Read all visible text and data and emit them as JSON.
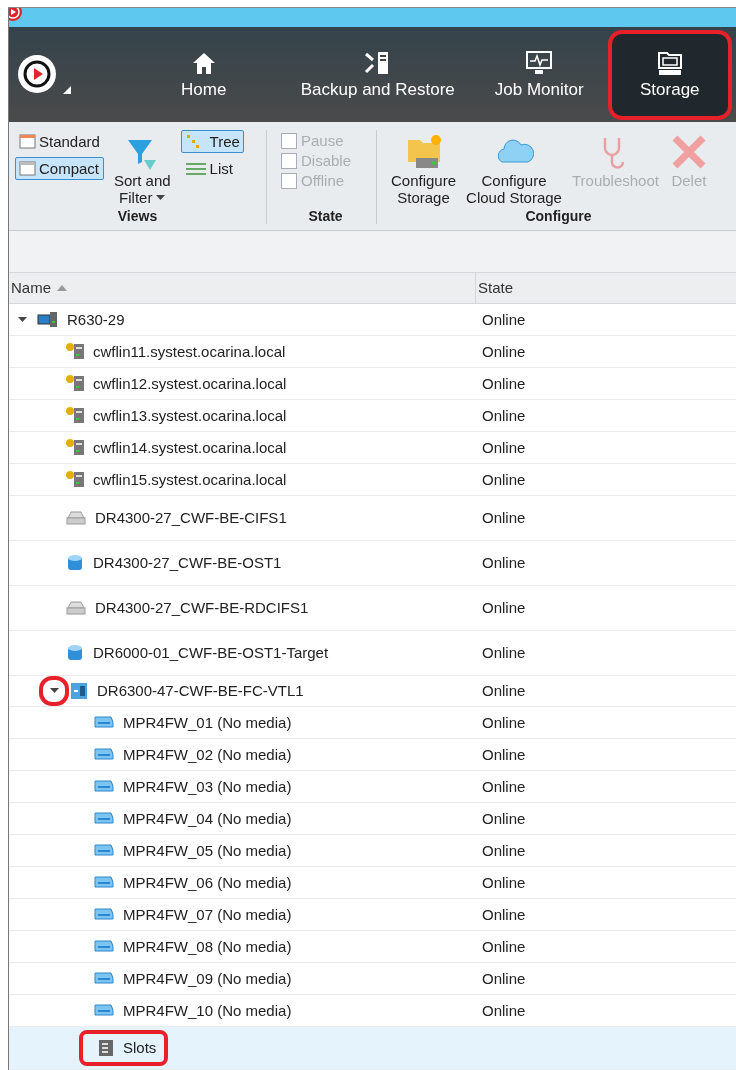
{
  "nav": {
    "items": [
      {
        "label": "Home",
        "selected": false,
        "annotated": false
      },
      {
        "label": "Backup and Restore",
        "selected": false,
        "annotated": false
      },
      {
        "label": "Job Monitor",
        "selected": false,
        "annotated": false
      },
      {
        "label": "Storage",
        "selected": true,
        "annotated": true
      }
    ]
  },
  "ribbon": {
    "groups": [
      {
        "label": "Views",
        "kind": "views",
        "layouts": [
          {
            "label": "Standard",
            "selected": false
          },
          {
            "label": "Compact",
            "selected": true
          }
        ],
        "sort": {
          "label": "Sort and Filter"
        },
        "modes": [
          {
            "label": "Tree",
            "selected": true
          },
          {
            "label": "List",
            "selected": false
          }
        ]
      },
      {
        "label": "State",
        "kind": "state",
        "options": [
          {
            "label": "Pause",
            "checked": false,
            "disabled": true
          },
          {
            "label": "Disable",
            "checked": false,
            "disabled": true
          },
          {
            "label": "Offline",
            "checked": false,
            "disabled": true
          }
        ]
      },
      {
        "label": "Configure",
        "kind": "configure",
        "buttons": [
          {
            "label": "Configure Storage",
            "disabled": false
          },
          {
            "label": "Configure Cloud Storage",
            "disabled": false
          },
          {
            "label": "Troubleshoot",
            "disabled": true
          },
          {
            "label": "Delet",
            "disabled": true
          }
        ]
      }
    ]
  },
  "table": {
    "columns": [
      {
        "label": "Name",
        "sorted": true
      },
      {
        "label": "State",
        "sorted": false
      }
    ],
    "rows": [
      {
        "name": "R630-29",
        "state": "Online",
        "kind": "host",
        "expanded": true,
        "selected": false,
        "children": [
          {
            "name": "cwflin11.systest.ocarina.local",
            "state": "Online",
            "kind": "client",
            "selected": false
          },
          {
            "name": "cwflin12.systest.ocarina.local",
            "state": "Online",
            "kind": "client",
            "selected": false
          },
          {
            "name": "cwflin13.systest.ocarina.local",
            "state": "Online",
            "kind": "client",
            "selected": false
          },
          {
            "name": "cwflin14.systest.ocarina.local",
            "state": "Online",
            "kind": "client",
            "selected": false
          },
          {
            "name": "cwflin15.systest.ocarina.local",
            "state": "Online",
            "kind": "client",
            "selected": false
          },
          {
            "name": "DR4300-27_CWF-BE-CIFS1",
            "state": "Online",
            "kind": "share",
            "selected": false
          },
          {
            "name": "DR4300-27_CWF-BE-OST1",
            "state": "Online",
            "kind": "ost",
            "selected": false
          },
          {
            "name": "DR4300-27_CWF-BE-RDCIFS1",
            "state": "Online",
            "kind": "share",
            "selected": false
          },
          {
            "name": "DR6000-01_CWF-BE-OST1-Target",
            "state": "Online",
            "kind": "ost",
            "selected": false
          },
          {
            "name": "DR6300-47-CWF-BE-FC-VTL1",
            "state": "Online",
            "kind": "library",
            "expanded": true,
            "selected": false,
            "annotated": true,
            "children": [
              {
                "name": "MPR4FW_01 (No media)",
                "state": "Online",
                "kind": "drive",
                "selected": false
              },
              {
                "name": "MPR4FW_02 (No media)",
                "state": "Online",
                "kind": "drive",
                "selected": false
              },
              {
                "name": "MPR4FW_03 (No media)",
                "state": "Online",
                "kind": "drive",
                "selected": false
              },
              {
                "name": "MPR4FW_04 (No media)",
                "state": "Online",
                "kind": "drive",
                "selected": false
              },
              {
                "name": "MPR4FW_05 (No media)",
                "state": "Online",
                "kind": "drive",
                "selected": false
              },
              {
                "name": "MPR4FW_06 (No media)",
                "state": "Online",
                "kind": "drive",
                "selected": false
              },
              {
                "name": "MPR4FW_07 (No media)",
                "state": "Online",
                "kind": "drive",
                "selected": false
              },
              {
                "name": "MPR4FW_08 (No media)",
                "state": "Online",
                "kind": "drive",
                "selected": false
              },
              {
                "name": "MPR4FW_09 (No media)",
                "state": "Online",
                "kind": "drive",
                "selected": false
              },
              {
                "name": "MPR4FW_10 (No media)",
                "state": "Online",
                "kind": "drive",
                "selected": false
              },
              {
                "name": "Slots",
                "kind": "slots",
                "selected": true,
                "annotated": true
              }
            ]
          }
        ]
      }
    ]
  }
}
